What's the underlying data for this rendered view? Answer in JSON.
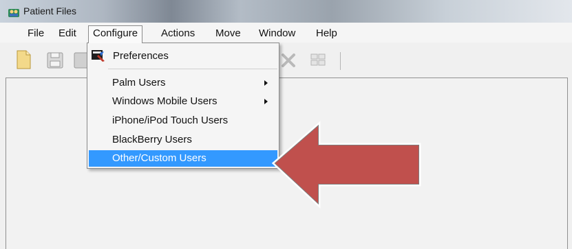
{
  "window": {
    "title": "Patient Files"
  },
  "menubar": {
    "items": [
      {
        "label": "File"
      },
      {
        "label": "Edit"
      },
      {
        "label": "Configure"
      },
      {
        "label": "Actions"
      },
      {
        "label": "Move"
      },
      {
        "label": "Window"
      },
      {
        "label": "Help"
      }
    ],
    "open_menu": "Configure"
  },
  "configure_menu": {
    "items": [
      {
        "label": "Preferences",
        "icon": "preferences-icon"
      },
      {
        "label": "Palm Users",
        "submenu": true
      },
      {
        "label": "Windows Mobile Users",
        "submenu": true
      },
      {
        "label": "iPhone/iPod Touch Users"
      },
      {
        "label": "BlackBerry Users"
      },
      {
        "label": "Other/Custom Users",
        "highlighted": true
      }
    ]
  },
  "toolbar": {
    "buttons": [
      "new-file-icon",
      "save-icon",
      "save-all-icon",
      "delete-icon",
      "grid-view-icon"
    ]
  },
  "annotation": {
    "icon": "callout-arrow-icon",
    "color": "#c0504d"
  },
  "colors": {
    "highlight": "#3399ff",
    "arrow_fill": "#c0504d"
  }
}
